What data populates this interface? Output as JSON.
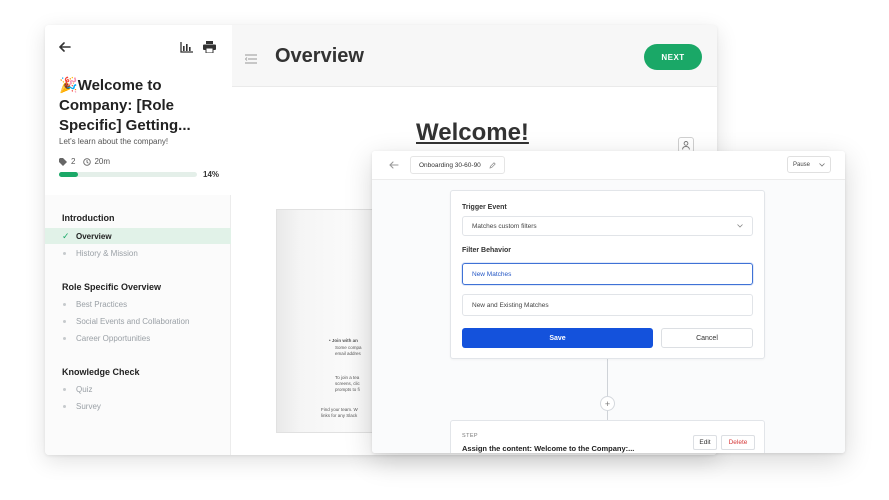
{
  "course": {
    "emoji": "🎉",
    "title": "Welcome to Company: [Role Specific] Getting...",
    "subtitle": "Let's learn about the company!",
    "tag_count": "2",
    "duration": "20m",
    "progress_percent": 14,
    "progress_label": "14%",
    "icons": {
      "back": "arrow-left-icon",
      "stats": "bar-chart-icon",
      "print": "printer-icon"
    }
  },
  "sidebar": {
    "sections": [
      {
        "title": "Introduction",
        "items": [
          {
            "label": "Overview",
            "active": true
          },
          {
            "label": "History & Mission",
            "active": false
          }
        ]
      },
      {
        "title": "Role Specific Overview",
        "items": [
          {
            "label": "Best Practices",
            "active": false
          },
          {
            "label": "Social Events and Collaboration",
            "active": false
          },
          {
            "label": "Career Opportunities",
            "active": false
          }
        ]
      },
      {
        "title": "Knowledge Check",
        "items": [
          {
            "label": "Quiz",
            "active": false
          },
          {
            "label": "Survey",
            "active": false
          }
        ]
      }
    ]
  },
  "main": {
    "page_title": "Overview",
    "next_label": "NEXT",
    "welcome_heading": "Welcome!",
    "doc_lines": [
      "Join with an",
      "Some compa",
      "email addres",
      "To join a tea",
      "screens, clic",
      "prompts to fi",
      "Find your team. W",
      "links for any Slack"
    ]
  },
  "workflow": {
    "name": "Onboarding 30-60-90",
    "status_select": "Pause",
    "trigger_label": "Trigger Event",
    "trigger_value": "Matches custom filters",
    "filter_label": "Filter Behavior",
    "filter_options": [
      {
        "label": "New Matches",
        "selected": true
      },
      {
        "label": "New and Existing Matches",
        "selected": false
      }
    ],
    "save_label": "Save",
    "cancel_label": "Cancel",
    "step": {
      "tag": "STEP",
      "title": "Assign the content: Welcome to the Company:...",
      "edit_label": "Edit",
      "delete_label": "Delete"
    },
    "colors": {
      "primary": "#1452dc",
      "danger": "#d63b3b",
      "accent_green": "#1aa867"
    }
  }
}
